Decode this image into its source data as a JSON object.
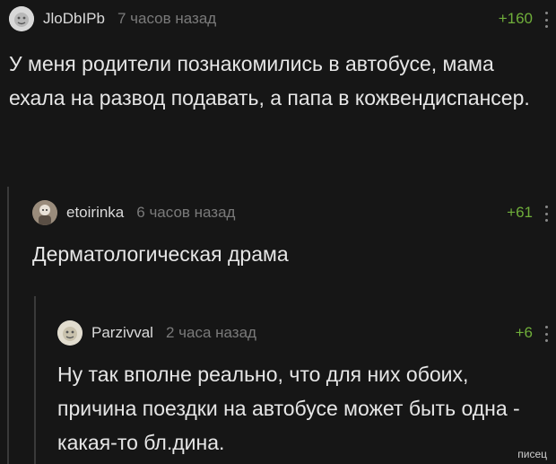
{
  "comments": [
    {
      "author": "JloDbIPb",
      "time": "7 часов назад",
      "rating": "+160",
      "text": "У меня родители познакомились в автобусе, мама ехала на развод подавать, а папа в кожвендиспансер."
    },
    {
      "author": "etoirinka",
      "time": "6 часов назад",
      "rating": "+61",
      "text": "Дерматологическая драма"
    },
    {
      "author": "Parzivval",
      "time": "2 часа назад",
      "rating": "+6",
      "text": "Ну так вполне реально, что для них обоих, причина поездки на автобусе может быть одна - какая-то бл.дина."
    }
  ],
  "icons": {
    "more": "more-vertical-icon",
    "avatar": "user-avatar"
  },
  "colors": {
    "background": "#161616",
    "rating": "#6fae3a",
    "muted": "#7a7a7a"
  },
  "watermark": "писец"
}
